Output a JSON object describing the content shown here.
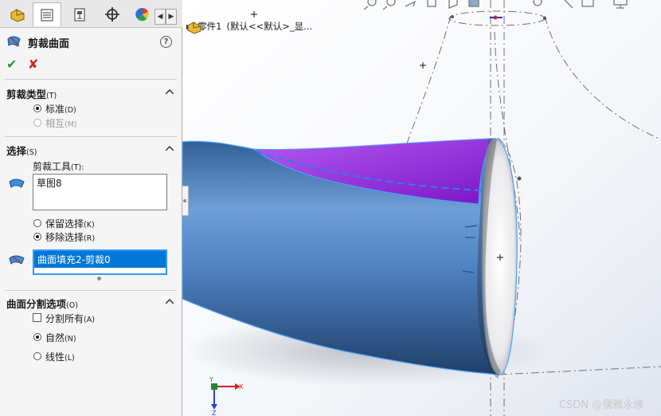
{
  "tabs": [
    {
      "name": "feature-manager-tab"
    },
    {
      "name": "property-manager-tab",
      "active": true
    },
    {
      "name": "configuration-manager-tab"
    },
    {
      "name": "dimxpert-manager-tab"
    },
    {
      "name": "display-manager-tab"
    }
  ],
  "feature": {
    "title": "剪裁曲面",
    "help": "?"
  },
  "actions": {
    "ok": "✔",
    "cancel": "✘"
  },
  "trim_type": {
    "title": "剪裁类型",
    "title_key": "(T)",
    "options": [
      {
        "label": "标准",
        "key": "(D)",
        "selected": true,
        "disabled": false
      },
      {
        "label": "相互",
        "key": "(M)",
        "selected": false,
        "disabled": true
      }
    ]
  },
  "selections": {
    "title": "选择",
    "title_key": "(S)",
    "trim_tool_label": "剪裁工具",
    "trim_tool_key": "(T):",
    "trim_tool_items": [
      "草图8"
    ],
    "keep_remove": [
      {
        "label": "保留选择",
        "key": "(K)",
        "selected": false
      },
      {
        "label": "移除选择",
        "key": "(R)",
        "selected": true
      }
    ],
    "pieces_items": [
      "曲面填充2-剪裁0"
    ]
  },
  "split_options": {
    "title": "曲面分割选项",
    "title_key": "(O)",
    "split_all": {
      "label": "分割所有",
      "key": "(A)",
      "checked": false
    },
    "options": [
      {
        "label": "自然",
        "key": "(N)",
        "selected": true
      },
      {
        "label": "线性",
        "key": "(L)",
        "selected": false
      }
    ]
  },
  "tree": {
    "part_name": "零件1",
    "config": "(默认<<默认>_显..."
  },
  "triad": {
    "x": "X",
    "y": "Y",
    "z": "Z"
  },
  "watermark": "CSDN @儒雅永缘",
  "colors": {
    "surface": "#4a7fc0",
    "trim_region": "#8a1fd8",
    "ok": "#1e9a3c",
    "cancel": "#d32020",
    "selection": "#0078d7"
  }
}
